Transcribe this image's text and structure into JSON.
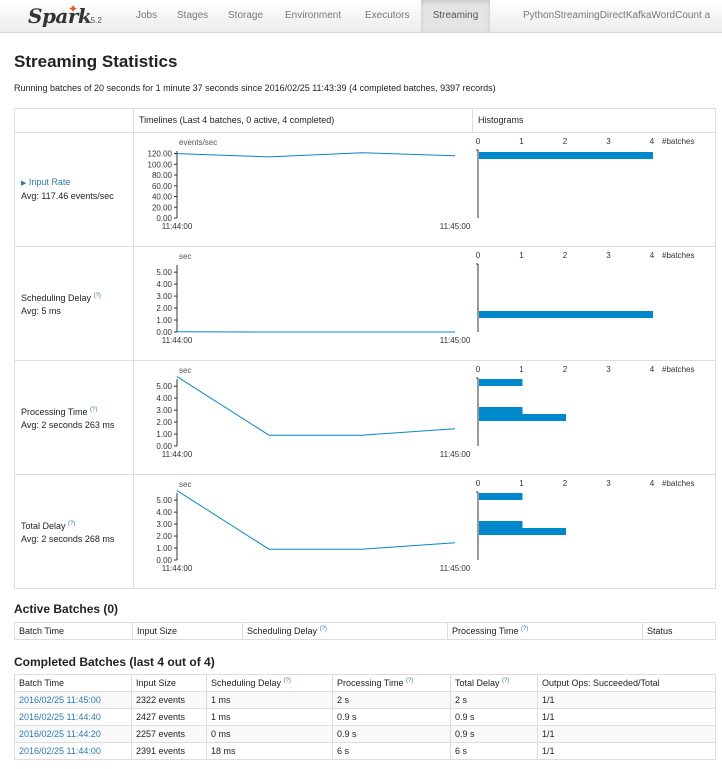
{
  "navbar": {
    "brand": "Spark",
    "version": "1.5.2",
    "tabs": [
      "Jobs",
      "Stages",
      "Storage",
      "Environment",
      "Executors",
      "Streaming"
    ],
    "active_tab": "Streaming",
    "app_name": "PythonStreamingDirectKafkaWordCount a"
  },
  "page": {
    "title": "Streaming Statistics",
    "subtitle": "Running batches of 20 seconds for 1 minute 37 seconds since 2016/02/25 11:43:39 (4 completed batches, 9397 records)"
  },
  "stats_table": {
    "col_timelines": "Timelines (Last 4 batches, 0 active, 4 completed)",
    "col_histograms": "Histograms",
    "rows": [
      {
        "name": "Input Rate",
        "avg": "Avg: 117.46 events/sec",
        "unit": "events/sec",
        "timeline": {
          "x_labels": [
            "11:44:00",
            "11:45:00"
          ],
          "y_ticks": [
            "0.00",
            "20.00",
            "40.00",
            "60.00",
            "80.00",
            "100.00",
            "120.00"
          ],
          "values": [
            120.0,
            113.8,
            121.5,
            116.1
          ]
        },
        "histogram": {
          "x_ticks": [
            "0",
            "1",
            "2",
            "3",
            "4"
          ],
          "x_label": "#batches",
          "counts": [
            4
          ]
        }
      },
      {
        "name": "Scheduling Delay",
        "avg": "Avg: 5 ms",
        "unit": "sec",
        "timeline": {
          "x_labels": [
            "11:44:00",
            "11:45:00"
          ],
          "y_ticks": [
            "0.00",
            "1.00",
            "2.00",
            "3.00",
            "4.00",
            "5.00"
          ],
          "values": [
            0.018,
            0.0,
            0.001,
            0.001
          ]
        },
        "histogram": {
          "x_ticks": [
            "0",
            "1",
            "2",
            "3",
            "4"
          ],
          "x_label": "#batches",
          "counts": [
            4
          ]
        }
      },
      {
        "name": "Processing Time",
        "avg": "Avg: 2 seconds 263 ms",
        "unit": "sec",
        "timeline": {
          "x_labels": [
            "11:44:00",
            "11:45:00"
          ],
          "y_ticks": [
            "0.00",
            "1.00",
            "2.00",
            "3.00",
            "4.00",
            "5.00"
          ],
          "values": [
            5.8,
            0.9,
            0.9,
            1.45
          ]
        },
        "histogram": {
          "x_ticks": [
            "0",
            "1",
            "2",
            "3",
            "4"
          ],
          "x_label": "#batches",
          "counts": [
            1,
            0,
            0,
            0,
            1,
            2
          ]
        }
      },
      {
        "name": "Total Delay",
        "avg": "Avg: 2 seconds 268 ms",
        "unit": "sec",
        "timeline": {
          "x_labels": [
            "11:44:00",
            "11:45:00"
          ],
          "y_ticks": [
            "0.00",
            "1.00",
            "2.00",
            "3.00",
            "4.00",
            "5.00"
          ],
          "values": [
            5.8,
            0.9,
            0.9,
            1.45
          ]
        },
        "histogram": {
          "x_ticks": [
            "0",
            "1",
            "2",
            "3",
            "4"
          ],
          "x_label": "#batches",
          "counts": [
            1,
            0,
            0,
            0,
            1,
            2
          ]
        }
      }
    ],
    "help_icon": "(?)"
  },
  "active_batches": {
    "title": "Active Batches (0)",
    "headers": [
      "Batch Time",
      "Input Size",
      "Scheduling Delay",
      "Processing Time",
      "Status"
    ]
  },
  "completed_batches": {
    "title": "Completed Batches (last 4 out of 4)",
    "headers": [
      "Batch Time",
      "Input Size",
      "Scheduling Delay",
      "Processing Time",
      "Total Delay",
      "Output Ops: Succeeded/Total"
    ],
    "rows": [
      [
        "2016/02/25 11:45:00",
        "2322 events",
        "1 ms",
        "2 s",
        "2 s",
        "1/1"
      ],
      [
        "2016/02/25 11:44:40",
        "2427 events",
        "1 ms",
        "0.9 s",
        "0.9 s",
        "1/1"
      ],
      [
        "2016/02/25 11:44:20",
        "2257 events",
        "0 ms",
        "0.9 s",
        "0.9 s",
        "1/1"
      ],
      [
        "2016/02/25 11:44:00",
        "2391 events",
        "18 ms",
        "6 s",
        "6 s",
        "1/1"
      ]
    ]
  },
  "colors": {
    "accent": "#0088cc",
    "link": "#2b7bb9",
    "brand_star": "#e25a1c"
  }
}
